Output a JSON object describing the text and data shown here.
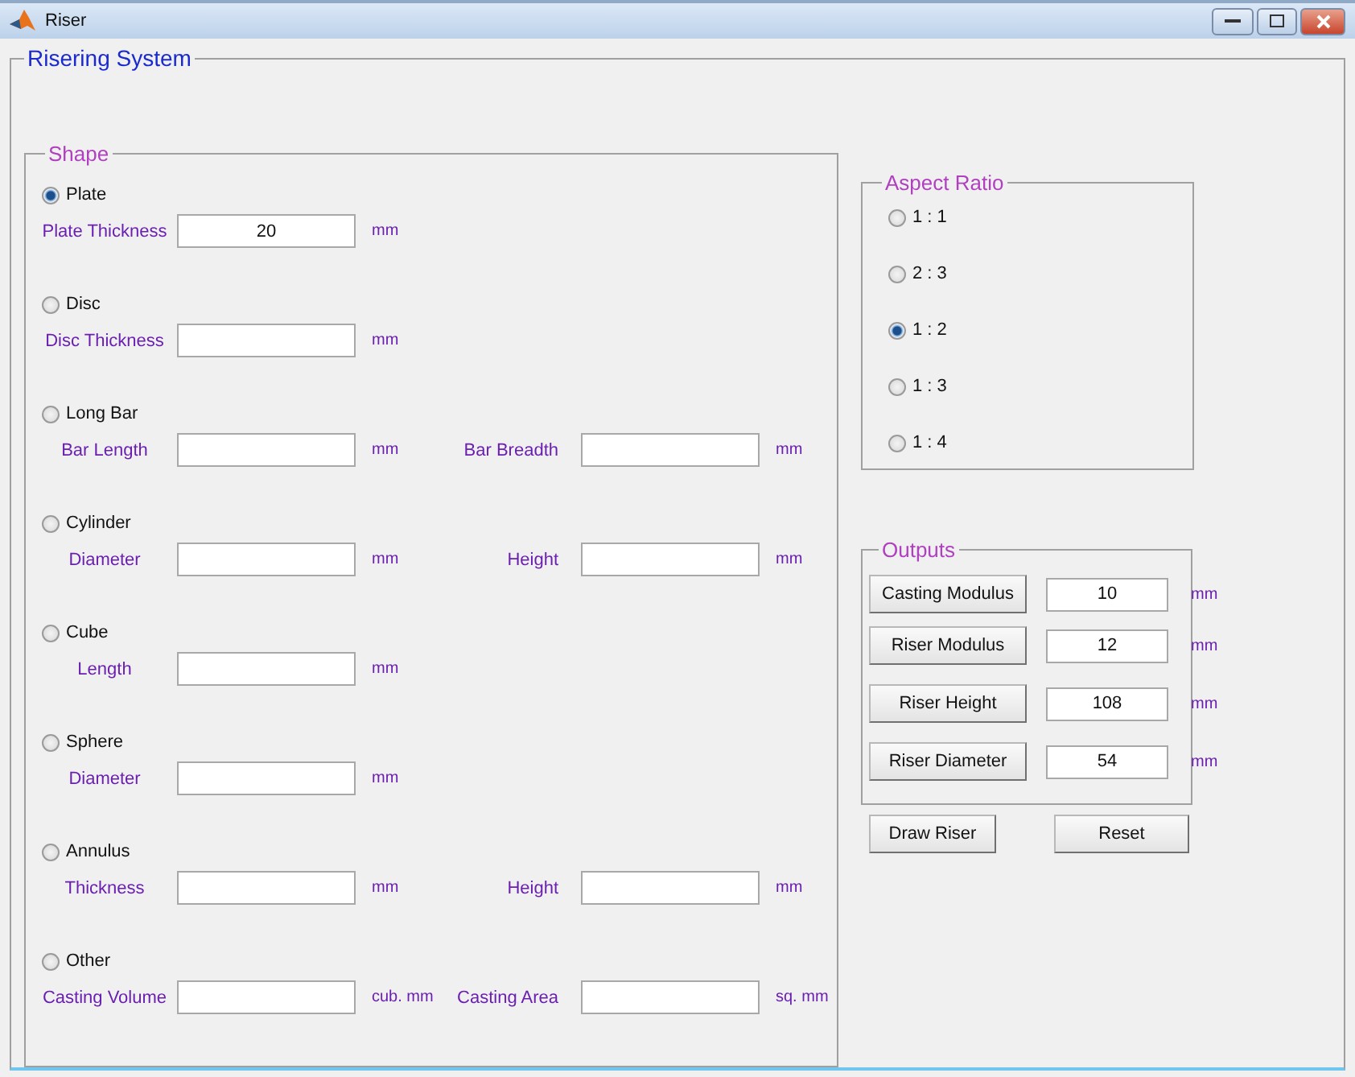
{
  "window": {
    "title": "Riser"
  },
  "main_panel": {
    "title": "Risering System"
  },
  "shape_panel": {
    "title": "Shape",
    "shapes": [
      {
        "label": "Plate",
        "selected": true,
        "fields": [
          {
            "label": "Plate Thickness",
            "value": "20",
            "unit": "mm"
          }
        ]
      },
      {
        "label": "Disc",
        "selected": false,
        "fields": [
          {
            "label": "Disc Thickness",
            "unit": "mm"
          }
        ]
      },
      {
        "label": "Long Bar",
        "selected": false,
        "fields": [
          {
            "label": "Bar Length",
            "unit": "mm"
          },
          {
            "label": "Bar Breadth",
            "unit": "mm"
          }
        ]
      },
      {
        "label": "Cylinder",
        "selected": false,
        "fields": [
          {
            "label": "Diameter",
            "unit": "mm"
          },
          {
            "label": "Height",
            "unit": "mm"
          }
        ]
      },
      {
        "label": "Cube",
        "selected": false,
        "fields": [
          {
            "label": "Length",
            "unit": "mm"
          }
        ]
      },
      {
        "label": "Sphere",
        "selected": false,
        "fields": [
          {
            "label": "Diameter",
            "unit": "mm"
          }
        ]
      },
      {
        "label": "Annulus",
        "selected": false,
        "fields": [
          {
            "label": "Thickness",
            "unit": "mm"
          },
          {
            "label": "Height",
            "unit": "mm"
          }
        ]
      },
      {
        "label": "Other",
        "selected": false,
        "fields": [
          {
            "label": "Casting Volume",
            "unit": "cub. mm"
          },
          {
            "label": "Casting Area",
            "unit": "sq. mm"
          }
        ]
      }
    ]
  },
  "aspect_ratio": {
    "title": "Aspect Ratio",
    "options": [
      {
        "label": "1 : 1",
        "selected": false
      },
      {
        "label": "2 : 3",
        "selected": false
      },
      {
        "label": "1 : 2",
        "selected": true
      },
      {
        "label": "1 : 3",
        "selected": false
      },
      {
        "label": "1 : 4",
        "selected": false
      }
    ]
  },
  "outputs": {
    "title": "Outputs",
    "rows": [
      {
        "button": "Casting Modulus",
        "value": "10",
        "unit": "mm"
      },
      {
        "button": "Riser Modulus",
        "value": "12",
        "unit": "mm"
      },
      {
        "button": "Riser Height",
        "value": "108",
        "unit": "mm"
      },
      {
        "button": "Riser Diameter",
        "value": "54",
        "unit": "mm"
      }
    ]
  },
  "buttons": [
    "Draw Riser",
    "Reset"
  ]
}
